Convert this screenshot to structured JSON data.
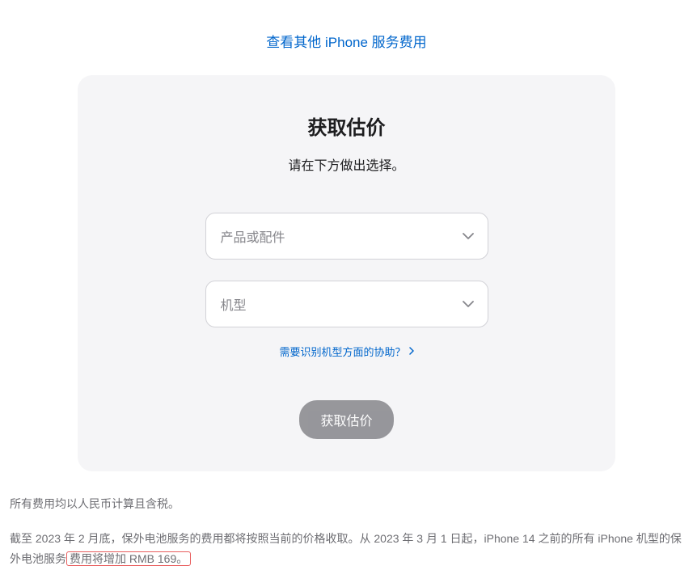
{
  "topLink": {
    "label": "查看其他 iPhone 服务费用"
  },
  "card": {
    "title": "获取估价",
    "subtitle": "请在下方做出选择。",
    "select1": {
      "placeholder": "产品或配件"
    },
    "select2": {
      "placeholder": "机型"
    },
    "helpLink": {
      "label": "需要识别机型方面的协助？"
    },
    "submitButton": {
      "label": "获取估价"
    }
  },
  "footer": {
    "line1": "所有费用均以人民币计算且含税。",
    "line2_part1": "截至 2023 年 2 月底，保外电池服务的费用都将按照当前的价格收取。从 2023 年 3 月 1 日起，iPhone 14 之前的所有 iPhone 机型的保外电池服务",
    "line2_highlight": "费用将增加 RMB 169。"
  }
}
